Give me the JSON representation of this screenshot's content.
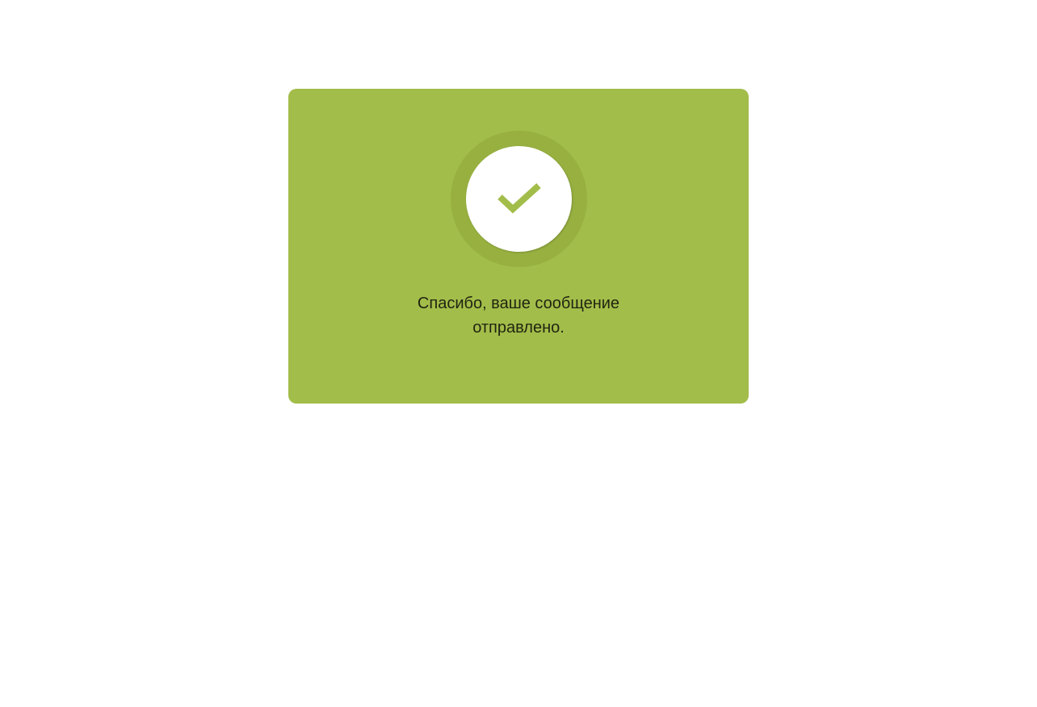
{
  "success_card": {
    "background_color": "#a3bd4a",
    "icon": "checkmark-icon",
    "message": "Спасибо, ваше сообщение отправлено."
  }
}
